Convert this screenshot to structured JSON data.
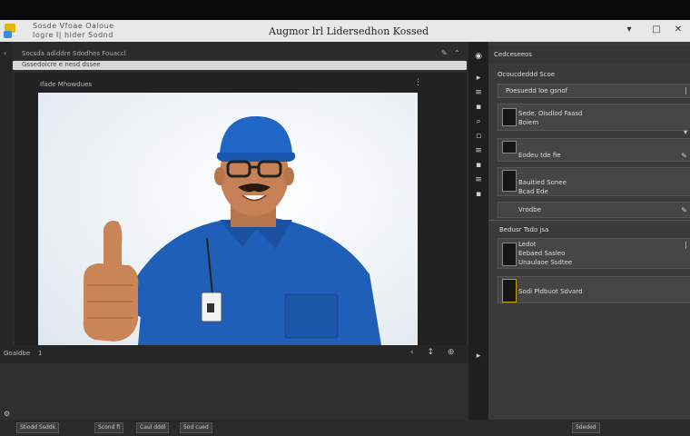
{
  "window": {
    "title": "Augmor lrl Lidersedhon Kossed",
    "menu_line_1": "Sosde  Vfoae  Oaloue",
    "menu_line_2": "Iogre  I|  hider Sodnd",
    "minimize": "▾",
    "maximize": "□",
    "close": "✕"
  },
  "editor": {
    "path_text": "Socsda adiddre   Sdodhes Fouaccl",
    "address_text": "Gssedoicre  e  nesd  dssee",
    "document_label": "Ifade Mhowdues",
    "menu_dots": "⋮",
    "footer_label": "Goaldbe",
    "footer_number": "1",
    "footer_icons": "‹ ↕ ⊕",
    "settings_icon": "⚙"
  },
  "toolstrip": {
    "tools": [
      "◉",
      "▸",
      "≡",
      "▪",
      "⌕",
      "▫",
      "≡",
      "▪",
      "≡",
      "▪",
      "▸"
    ]
  },
  "panel": {
    "header": "Cedceseeos",
    "subheader": "Ocoucdeddd  Scoe",
    "items": [
      {
        "label": "Poesuedd loe gsnof",
        "sub": ""
      },
      {
        "label": "Sede. Oisdlod Faasd",
        "sub": "Boiem"
      },
      {
        "label": "Eodeu tde fie",
        "sub": ""
      },
      {
        "label": "Bauitied Sonee",
        "sub": "Bcad Ede"
      },
      {
        "label": "Vrodbe",
        "sub": ""
      }
    ],
    "section2_label": "Bedusr  Tsdo jsa",
    "section2_items": [
      {
        "label": "Ledot",
        "sub": "Eebaed Sasleo",
        "sub2": "Unaulaoe Ssdtee"
      },
      {
        "label": "Sodi  Pldbuot Sdvard",
        "sub": ""
      }
    ]
  },
  "statusbar": {
    "segments": [
      "Stiodd Ssddk",
      "Scond  fl",
      "Caul dddl",
      "Sod  cued"
    ],
    "right_segment": "Sdeded"
  },
  "colors": {
    "accent_yellow": "#e6b500",
    "accent_blue": "#3b8de0",
    "shirt_blue": "#1f5fb8",
    "cap_blue": "#1f66c6"
  }
}
